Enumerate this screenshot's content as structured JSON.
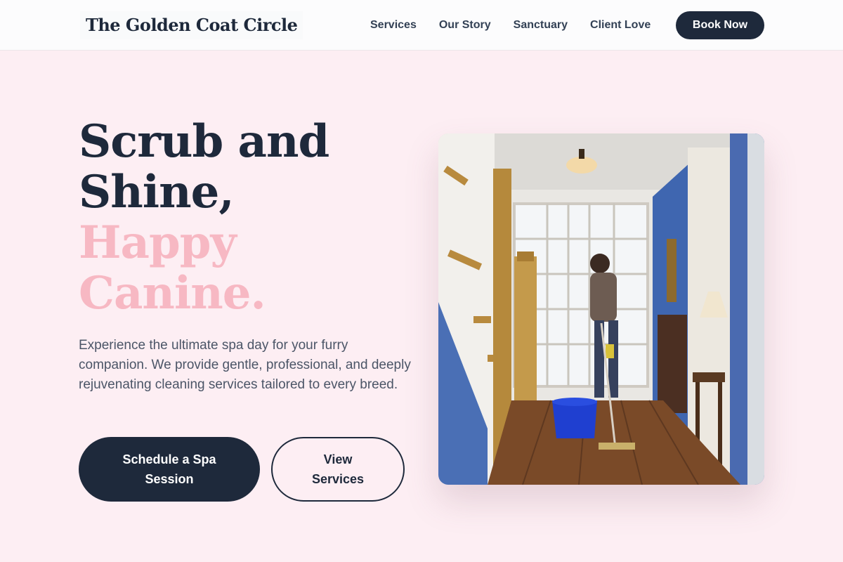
{
  "header": {
    "logo": "The Golden Coat Circle",
    "nav": [
      "Services",
      "Our Story",
      "Sanctuary",
      "Client Love"
    ],
    "cta": "Book Now"
  },
  "hero": {
    "headline_dark": [
      "Scrub and",
      "Shine,"
    ],
    "headline_pink": [
      "Happy",
      "Canine."
    ],
    "intro": "Experience the ultimate spa day for your furry companion. We provide gentle, professional, and deeply rejuvenating cleaning services tailored to every breed.",
    "primary_button": "Schedule a Spa Session",
    "secondary_button": "View Services"
  },
  "colors": {
    "background": "#fdeef3",
    "navy": "#1e293b",
    "pink_accent": "#f7b8c3",
    "body_text": "#4b5567"
  }
}
